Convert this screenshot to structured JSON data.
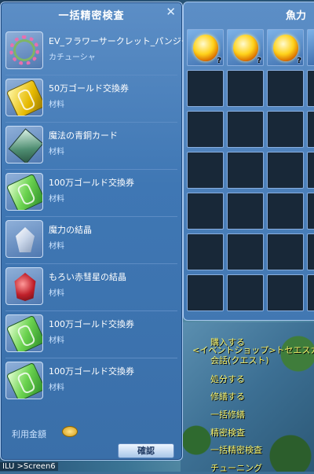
{
  "window": {
    "title": "一括精密検査",
    "close_glyph": "✕"
  },
  "items": [
    {
      "icon": "flower-wreath-icon",
      "name": "EV_フラワーサークレット_パンジー",
      "type": "カチューシャ"
    },
    {
      "icon": "gold-ticket-icon",
      "name": "50万ゴールド交換券",
      "type": "材料"
    },
    {
      "icon": "bronze-card-icon",
      "name": "魔法の青銅カード",
      "type": "材料"
    },
    {
      "icon": "green-ticket-icon",
      "name": "100万ゴールド交換券",
      "type": "材料"
    },
    {
      "icon": "crystal-icon",
      "name": "魔力の結晶",
      "type": "材料"
    },
    {
      "icon": "red-crystal-icon",
      "name": "もろい赤彗星の結晶",
      "type": "材料"
    },
    {
      "icon": "green-ticket-icon",
      "name": "100万ゴールド交換券",
      "type": "材料"
    },
    {
      "icon": "green-ticket-icon",
      "name": "100万ゴールド交換券",
      "type": "材料"
    }
  ],
  "footer": {
    "fee_label": "利用金額",
    "confirm_label": "確認"
  },
  "inventory": {
    "title": "魚力",
    "slot_mark": "?"
  },
  "npc_menu": {
    "items": [
      "購入する",
      "会話(クエスト)",
      "処分する",
      "修繕する",
      "一括修繕",
      "精密検査",
      "一括精密検査",
      "チューニング"
    ],
    "overlap_text": "<イベントショップ>トセエスカ"
  },
  "status": {
    "text": "ILU >Screen6"
  }
}
